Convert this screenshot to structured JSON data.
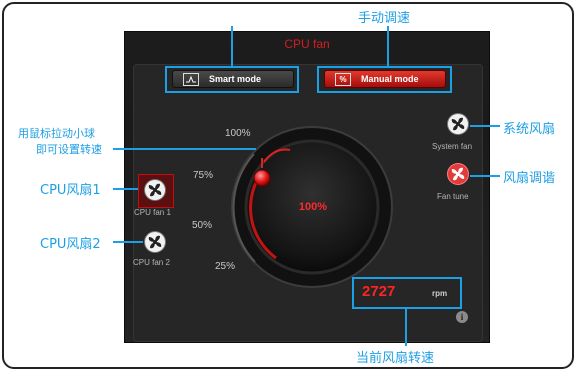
{
  "panel": {
    "title": "CPU fan"
  },
  "modes": {
    "smart_label": "Smart mode",
    "manual_label": "Manual mode",
    "manual_icon_text": "%"
  },
  "dial": {
    "value_label": "100%",
    "ticks": [
      "100%",
      "75%",
      "50%",
      "25%"
    ],
    "level_percent": 100
  },
  "fans": {
    "cpu_fan_1": "CPU fan 1",
    "cpu_fan_2": "CPU fan 2",
    "system_fan": "System fan",
    "fan_tune": "Fan tune"
  },
  "rpm": {
    "value": "2727",
    "unit": "rpm"
  },
  "annotations": {
    "manual_speed": "手动调速",
    "drag_hint_line1": "用鼠标拉动小球",
    "drag_hint_line2": "即可设置转速",
    "cpu_fan_1": "CPU风扇1",
    "cpu_fan_2": "CPU风扇2",
    "system_fan": "系统风扇",
    "fan_tune": "风扇调谐",
    "current_speed": "当前风扇转速"
  },
  "colors": {
    "accent": "#1d9fe5",
    "brand_red": "#d41e1e"
  },
  "icons": {
    "fan": "fan-icon",
    "info": "info-icon",
    "graph": "graph-icon"
  }
}
